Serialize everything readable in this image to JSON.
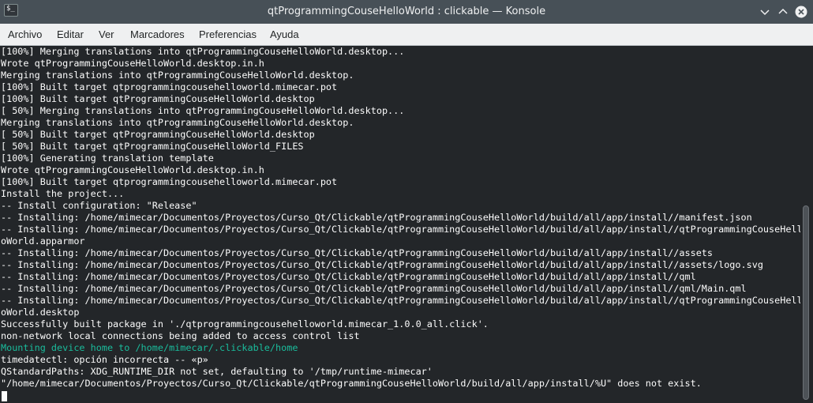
{
  "window": {
    "title": "qtProgrammingCouseHelloWorld : clickable — Konsole",
    "icon": "$_"
  },
  "titlebar_buttons": [
    "minimize-icon",
    "maximize-icon",
    "close-icon"
  ],
  "menu": [
    "Archivo",
    "Editar",
    "Ver",
    "Marcadores",
    "Preferencias",
    "Ayuda"
  ],
  "terminal": {
    "lines": [
      "[100%] Merging translations into qtProgrammingCouseHelloWorld.desktop...",
      "Wrote qtProgrammingCouseHelloWorld.desktop.in.h",
      "Merging translations into qtProgrammingCouseHelloWorld.desktop.",
      "[100%] Built target qtprogrammingcousehelloworld.mimecar.pot",
      "[100%] Built target qtProgrammingCouseHelloWorld.desktop",
      "[ 50%] Merging translations into qtProgrammingCouseHelloWorld.desktop...",
      "Merging translations into qtProgrammingCouseHelloWorld.desktop.",
      "[ 50%] Built target qtProgrammingCouseHelloWorld.desktop",
      "[ 50%] Built target qtProgrammingCouseHelloWorld_FILES",
      "[100%] Generating translation template",
      "Wrote qtProgrammingCouseHelloWorld.desktop.in.h",
      "[100%] Built target qtprogrammingcousehelloworld.mimecar.pot",
      "Install the project...",
      "-- Install configuration: \"Release\"",
      "-- Installing: /home/mimecar/Documentos/Proyectos/Curso_Qt/Clickable/qtProgrammingCouseHelloWorld/build/all/app/install//manifest.json",
      "-- Installing: /home/mimecar/Documentos/Proyectos/Curso_Qt/Clickable/qtProgrammingCouseHelloWorld/build/all/app/install//qtProgrammingCouseHell",
      "oWorld.apparmor",
      "-- Installing: /home/mimecar/Documentos/Proyectos/Curso_Qt/Clickable/qtProgrammingCouseHelloWorld/build/all/app/install//assets",
      "-- Installing: /home/mimecar/Documentos/Proyectos/Curso_Qt/Clickable/qtProgrammingCouseHelloWorld/build/all/app/install//assets/logo.svg",
      "-- Installing: /home/mimecar/Documentos/Proyectos/Curso_Qt/Clickable/qtProgrammingCouseHelloWorld/build/all/app/install//qml",
      "-- Installing: /home/mimecar/Documentos/Proyectos/Curso_Qt/Clickable/qtProgrammingCouseHelloWorld/build/all/app/install//qml/Main.qml",
      "-- Installing: /home/mimecar/Documentos/Proyectos/Curso_Qt/Clickable/qtProgrammingCouseHelloWorld/build/all/app/install//qtProgrammingCouseHell",
      "oWorld.desktop",
      "Successfully built package in './qtprogrammingcousehelloworld.mimecar_1.0.0_all.click'.",
      "non-network local connections being added to access control list",
      "Mounting device home to /home/mimecar/.clickable/home",
      "timedatectl: opción incorrecta -- «p»",
      "QStandardPaths: XDG_RUNTIME_DIR not set, defaulting to '/tmp/runtime-mimecar'",
      "\"/home/mimecar/Documentos/Proyectos/Curso_Qt/Clickable/qtProgrammingCouseHelloWorld/build/all/app/install/%U\" does not exist."
    ],
    "highlighted_line_index": 25,
    "colors": {
      "background": "#232629",
      "foreground": "#fcfcfc",
      "highlight": "#1abc9c"
    }
  }
}
